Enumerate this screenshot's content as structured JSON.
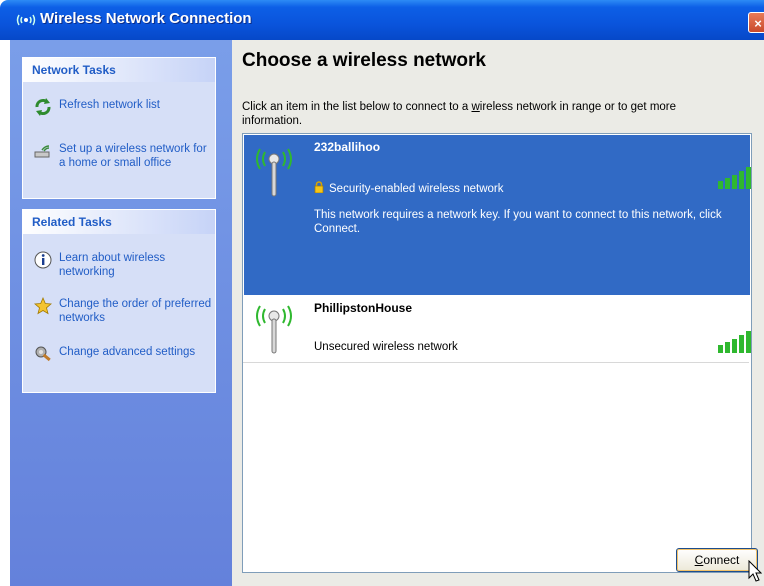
{
  "window": {
    "title": "Wireless Network Connection",
    "close_glyph": "×"
  },
  "sidebar": {
    "network_tasks": {
      "header": "Network Tasks",
      "items": [
        {
          "label": "Refresh network list",
          "icon": "refresh-icon"
        },
        {
          "label": "Set up a wireless network for a home or small office",
          "icon": "setup-wireless-icon"
        }
      ]
    },
    "related_tasks": {
      "header": "Related Tasks",
      "items": [
        {
          "label": "Learn about wireless networking",
          "icon": "info-icon"
        },
        {
          "label": "Change the order of preferred networks",
          "icon": "star-icon"
        },
        {
          "label": "Change advanced settings",
          "icon": "settings-icon"
        }
      ]
    }
  },
  "main": {
    "heading": "Choose a wireless network",
    "instructions_pre": "Click an item in the list below to connect to a ",
    "instructions_underlined": "w",
    "instructions_post": "ireless network in range or to get more information.",
    "networks": [
      {
        "name": "232ballihoo",
        "status": "Security-enabled wireless network",
        "description": "This network requires a network key. If you want to connect to this network, click Connect.",
        "selected": true,
        "secured": true,
        "signal_bars": 5
      },
      {
        "name": "PhillipstonHouse",
        "status": "Unsecured wireless network",
        "selected": false,
        "secured": false,
        "signal_bars": 5
      }
    ],
    "connect_label_underlined": "C",
    "connect_label_rest": "onnect"
  },
  "colors": {
    "title_bar": "#0a54dc",
    "sidebar": "#6e8fe2",
    "link": "#215dc6",
    "selection": "#316ac5",
    "signal_green": "#2fb82f"
  }
}
